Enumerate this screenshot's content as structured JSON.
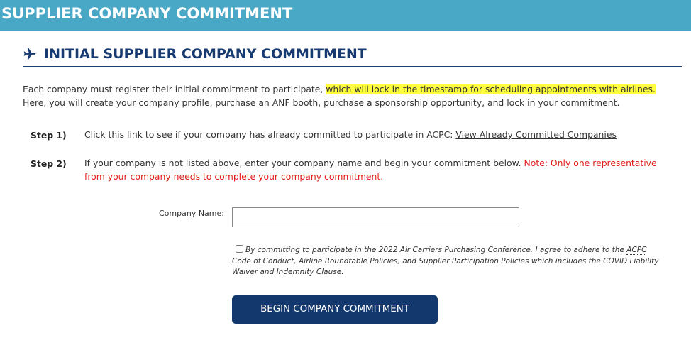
{
  "header": {
    "title": "SUPPLIER COMPANY COMMITMENT"
  },
  "section": {
    "icon": "airplane-icon",
    "title": "INITIAL SUPPLIER COMPANY COMMITMENT"
  },
  "intro": {
    "before": "Each company must register their initial commitment to participate, ",
    "highlight": "which will lock in the timestamp for scheduling appointments with airlines.",
    "after": " Here, you will create your company profile, purchase an ANF booth, purchase a sponsorship opportunity, and lock in your commitment."
  },
  "steps": [
    {
      "label": "Step 1)",
      "text": "Click this link to see if your company has already committed to participate in ACPC: ",
      "link": "View Already Committed Companies"
    },
    {
      "label": "Step 2)",
      "text": "If your company is not listed above, enter your company name and begin your commitment below. ",
      "note": "Note: Only one representative from your company needs to complete your company commitment."
    }
  ],
  "form": {
    "company_label": "Company Name:",
    "company_value": "",
    "company_placeholder": "",
    "agree_text_1": "By committing to participate in the 2022 Air Carriers Purchasing Conference, I agree to adhere to the ",
    "agree_link_1": "ACPC Code of Conduct",
    "agree_sep_1": ", ",
    "agree_link_2": "Airline Roundtable Policies",
    "agree_sep_2": ", and ",
    "agree_link_3": "Supplier Participation Policies",
    "agree_text_2": " which includes the COVID Liability Waiver and Indemnity Clause.",
    "agree_checked": false,
    "submit_label": "BEGIN COMPANY COMMITMENT"
  },
  "colors": {
    "header_bg": "#4aa8c7",
    "title_blue": "#173a70",
    "button_bg": "#12386e",
    "highlight": "#ffff3d",
    "note_red": "#e0201c"
  }
}
